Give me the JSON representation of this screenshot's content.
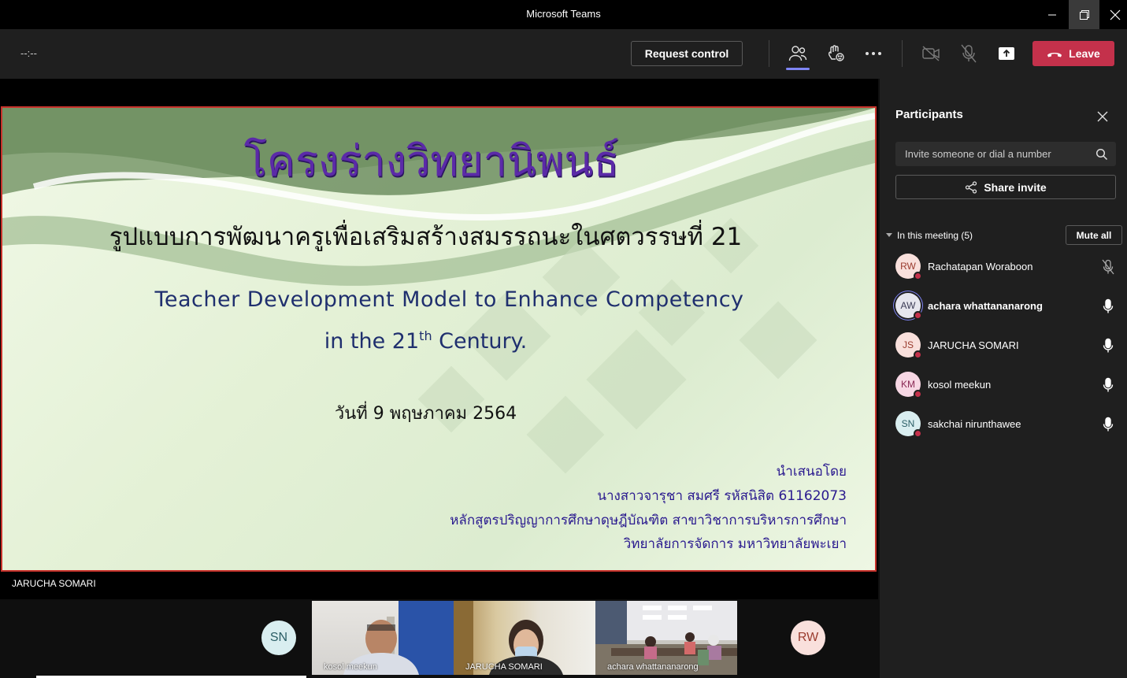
{
  "window": {
    "title": "Microsoft Teams",
    "controls": [
      "minimize-icon",
      "restore-icon",
      "close-icon"
    ]
  },
  "toolbar": {
    "timer": "--:--",
    "request_control_label": "Request control",
    "icons": [
      "participants-icon",
      "reactions-icon",
      "more-options-icon",
      "camera-off-icon",
      "mic-off-icon",
      "share-screen-icon"
    ],
    "leave_label": "Leave",
    "leave_color": "#c4314b",
    "active_color": "#7f85f5"
  },
  "slide": {
    "title_th": "โครงร่างวิทยานิพนธ์",
    "subtitle_th": "รูปแบบการพัฒนาครูเพื่อเสริมสร้างสมรรถนะในศตวรรษที่ 21",
    "title_en_line1": "Teacher Development  Model to Enhance Competency",
    "title_en_line2_pre": "in the 21",
    "title_en_line2_sup": "th",
    "title_en_line2_post": " Century.",
    "date_th": "วันที่ 9 พฤษภาคม 2564",
    "presented_by": "นำเสนอโดย",
    "presenter": "นางสาวจารุชา สมศรี รหัสนิสิต 61162073",
    "program": "หลักสูตรปริญญาการศึกษาดุษฎีบัณฑิต สาขาวิชาการบริหารการศึกษา",
    "college": "วิทยาลัยการจัดการ มหาวิทยาลัยพะเยา"
  },
  "stage": {
    "presenter_label": "JARUCHA SOMARI"
  },
  "participants_panel": {
    "title": "Participants",
    "search_placeholder": "Invite someone or dial a number",
    "share_invite_label": "Share invite",
    "in_meeting_label": "In this meeting (5)",
    "mute_all_label": "Mute all",
    "people": [
      {
        "initials": "RW",
        "name": "Rachatapan Woraboon",
        "mic": "mic-off-icon",
        "avatar_bg": "#f9e0dc",
        "avatar_fg": "#9a3b2e",
        "bold": false
      },
      {
        "initials": "AW",
        "name": "achara whattananarong",
        "mic": "mic-icon",
        "avatar_bg": "#e6e6ee",
        "avatar_fg": "#3b3b55",
        "bold": true
      },
      {
        "initials": "JS",
        "name": "JARUCHA SOMARI",
        "mic": "mic-icon",
        "avatar_bg": "#f9e0dc",
        "avatar_fg": "#9a3b2e",
        "bold": false
      },
      {
        "initials": "KM",
        "name": "kosol meekun",
        "mic": "mic-icon",
        "avatar_bg": "#f7d7e4",
        "avatar_fg": "#8a2a55",
        "bold": false
      },
      {
        "initials": "SN",
        "name": "sakchai nirunthawee",
        "mic": "mic-icon",
        "avatar_bg": "#d9eef0",
        "avatar_fg": "#2b5e66",
        "bold": false
      }
    ]
  },
  "gallery": {
    "left_avatar": "SN",
    "right_avatar": "RW",
    "tiles": [
      "kosol meekun",
      "JARUCHA SOMARI",
      "achara whattananarong"
    ]
  }
}
